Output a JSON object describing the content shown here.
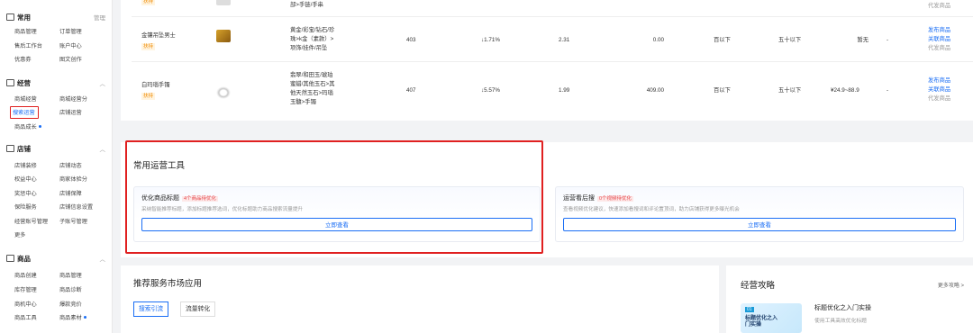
{
  "sidebar": {
    "common": {
      "title": "常用",
      "manage": "管理",
      "items": [
        "商品管理",
        "订单管理",
        "售后工作台",
        "账户中心",
        "优惠券",
        "图文创作"
      ]
    },
    "operations": {
      "title": "经营",
      "items": [
        "商城经营",
        "商城经营分",
        "搜索运营",
        "店铺运营",
        "商品成长"
      ]
    },
    "shop": {
      "title": "店铺",
      "items": [
        "店铺装修",
        "店铺动态",
        "权益中心",
        "商家体验分",
        "奖惩中心",
        "店铺保障",
        "保险服务",
        "店铺信息设置",
        "经营账号管理",
        "子账号管理",
        "更多"
      ]
    },
    "goods": {
      "title": "商品",
      "items": [
        "商品创建",
        "商品管理",
        "库存管理",
        "商品诊断",
        "商机中心",
        "爆款竞价",
        "商品工具",
        "商品素材"
      ]
    }
  },
  "table": {
    "row0": {
      "tail": "部>手链/手串",
      "action": "代发商品"
    },
    "rows": [
      {
        "name": "金镶吊坠男士",
        "badge": "扶持",
        "category": [
          "黄金/彩宝/钻石/珍",
          "珠>k金（素款）>",
          "项饰/挂件/吊坠"
        ],
        "search": "403",
        "change": "↓1.71%",
        "ratio": "2.31",
        "amount": "0.00",
        "lvl1": "百以下",
        "lvl2": "五十以下",
        "price": "暂无",
        "dash": "-",
        "actions": [
          "发布商品",
          "关联商品",
          "代发商品"
        ]
      },
      {
        "name": "白玛瑙手镯",
        "badge": "扶持",
        "category": [
          "翡翠/和田玉/琥珀",
          "蜜蜡/其他玉石>其",
          "他天然玉石>玛瑙",
          "玉髓>手镯"
        ],
        "search": "407",
        "change": "↓5.57%",
        "ratio": "1.99",
        "amount": "409.00",
        "lvl1": "百以下",
        "lvl2": "五十以下",
        "price": "¥24.9~88.9",
        "dash": "-",
        "actions": [
          "发布商品",
          "关联商品",
          "代发商品"
        ]
      }
    ]
  },
  "tools": {
    "title": "常用运营工具",
    "cards": [
      {
        "title": "优化商品标题",
        "badge": "4个商品待优化",
        "desc": "采纳智能推荐标题，添加标题推荐选词，优化标题助力商品搜索流量提升",
        "button": "立即查看"
      },
      {
        "title": "运营看后搜",
        "badge": "0个视频待优化",
        "desc": "查看视频优化建议，快速添加看搜词和评论置顶词，助力店铺获得更多曝光机会",
        "button": "立即查看"
      }
    ]
  },
  "market": {
    "title": "推荐服务市场应用",
    "tabs": [
      "搜索引流",
      "流量转化"
    ]
  },
  "guide": {
    "title": "经营攻略",
    "more": "更多攻略 >",
    "article_title": "标题优化之入门实操",
    "article_desc": "使用工具高效优化标题",
    "cover_text": "标题优化之入门实操",
    "cover_tag": "01"
  },
  "colors": {
    "accent": "#1a6ef5",
    "highlight": "#e02020",
    "badge": "#f08a00"
  }
}
